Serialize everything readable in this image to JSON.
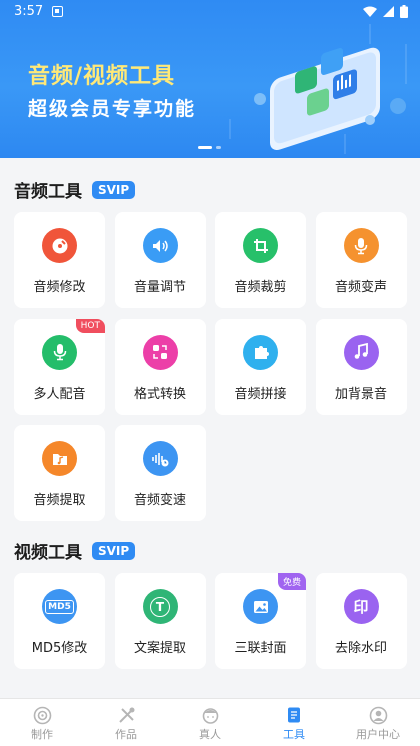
{
  "status_bar": {
    "time": "3:57"
  },
  "banner": {
    "title": "音频/视频工具",
    "subtitle": "超级会员专享功能",
    "slides": 2,
    "active_slide": 0
  },
  "audio_section": {
    "title": "音频工具",
    "badge": "SVIP",
    "tools": [
      {
        "label": "音频修改",
        "icon": "disc-edit-icon",
        "color": "#f0553a"
      },
      {
        "label": "音量调节",
        "icon": "volume-icon",
        "color": "#3a9cf5"
      },
      {
        "label": "音频裁剪",
        "icon": "crop-icon",
        "color": "#27c06a"
      },
      {
        "label": "音频变声",
        "icon": "microphone-icon",
        "color": "#f5922f"
      },
      {
        "label": "多人配音",
        "icon": "microphone-icon",
        "color": "#24bd6a",
        "badge": "HOT"
      },
      {
        "label": "格式转换",
        "icon": "convert-icon",
        "color": "#ec3fa8"
      },
      {
        "label": "音频拼接",
        "icon": "puzzle-icon",
        "color": "#2fb0ee"
      },
      {
        "label": "加背景音",
        "icon": "music-note-icon",
        "color": "#9a63f0"
      },
      {
        "label": "音频提取",
        "icon": "music-folder-icon",
        "color": "#f5872a"
      },
      {
        "label": "音频变速",
        "icon": "audio-speed-icon",
        "color": "#3d95f2"
      }
    ]
  },
  "video_section": {
    "title": "视频工具",
    "badge": "SVIP",
    "tools": [
      {
        "label": "MD5修改",
        "icon": "md5-icon",
        "color": "#3d95f2",
        "glyph": "MD5"
      },
      {
        "label": "文案提取",
        "icon": "text-extract-icon",
        "color": "#2fb576",
        "glyph": "T"
      },
      {
        "label": "三联封面",
        "icon": "image-icon",
        "color": "#3d95f2",
        "badge": "免费"
      },
      {
        "label": "去除水印",
        "icon": "seal-icon",
        "color": "#9a63f0",
        "glyph": "印"
      }
    ]
  },
  "tabbar": {
    "tabs": [
      {
        "label": "制作",
        "icon": "disc-icon"
      },
      {
        "label": "作品",
        "icon": "tools-icon"
      },
      {
        "label": "真人",
        "icon": "person-icon"
      },
      {
        "label": "工具",
        "icon": "document-icon",
        "active": true
      },
      {
        "label": "用户中心",
        "icon": "user-icon"
      }
    ]
  }
}
